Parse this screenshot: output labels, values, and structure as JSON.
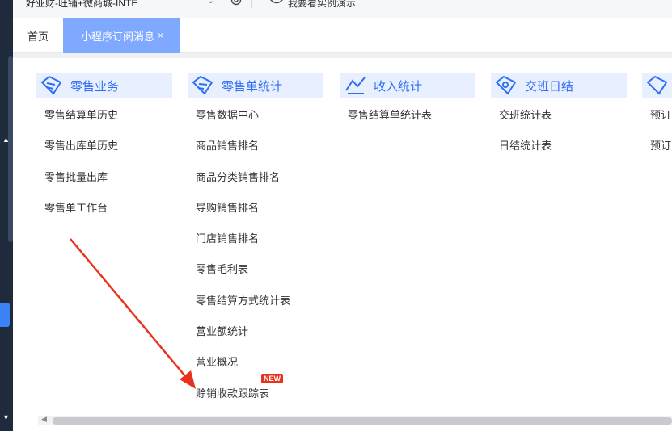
{
  "topbar": {
    "company": "好业财-旺铺+微商城-INTE",
    "demo_link": "我要看实例演示"
  },
  "tabs": {
    "home": "首页",
    "active": "小程序订阅消息",
    "close": "×"
  },
  "columns": [
    {
      "title": "零售业务",
      "icon": "retail-business-icon",
      "items": [
        "零售结算单历史",
        "零售出库单历史",
        "零售批量出库",
        "零售单工作台"
      ]
    },
    {
      "title": "零售单统计",
      "icon": "retail-stats-icon",
      "items": [
        "零售数据中心",
        "商品销售排名",
        "商品分类销售排名",
        "导购销售排名",
        "门店销售排名",
        "零售毛利表",
        "零售结算方式统计表",
        "营业额统计",
        "营业概况",
        "赊销收款跟踪表"
      ]
    },
    {
      "title": "收入统计",
      "icon": "income-stats-icon",
      "items": [
        "零售结算单统计表"
      ]
    },
    {
      "title": "交班日结",
      "icon": "shift-close-icon",
      "items": [
        "交班统计表",
        "日结统计表"
      ]
    },
    {
      "title": "",
      "icon": "reservation-icon",
      "items": [
        "预订",
        "预订"
      ]
    }
  ],
  "badges": {
    "new": "NEW"
  },
  "colors": {
    "accent": "#2f6df6",
    "tab_active": "#7fa8ff",
    "header_bg": "#e8f0ff",
    "sidebar": "#1f2a3d",
    "arrow": "#e8321d"
  }
}
